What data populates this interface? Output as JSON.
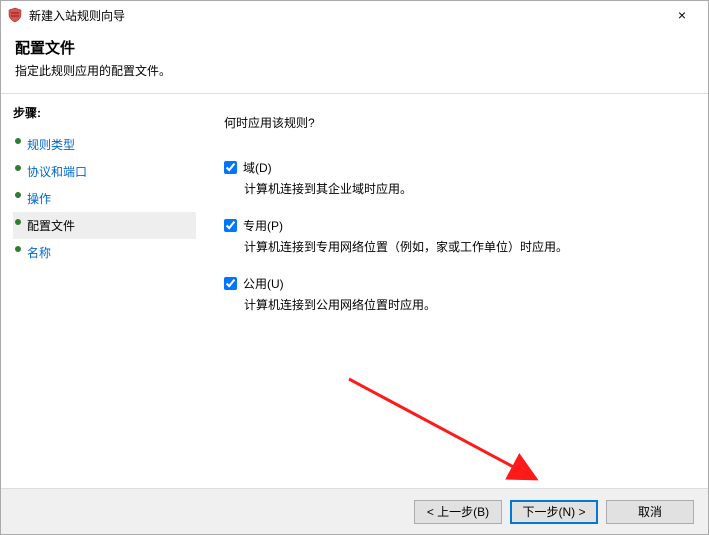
{
  "window": {
    "title": "新建入站规则向导",
    "close_label": "×"
  },
  "header": {
    "title": "配置文件",
    "subtitle": "指定此规则应用的配置文件。"
  },
  "sidebar": {
    "steps_label": "步骤:",
    "items": [
      {
        "label": "规则类型",
        "current": false
      },
      {
        "label": "协议和端口",
        "current": false
      },
      {
        "label": "操作",
        "current": false
      },
      {
        "label": "配置文件",
        "current": true
      },
      {
        "label": "名称",
        "current": false
      }
    ]
  },
  "main": {
    "prompt": "何时应用该规则?",
    "options": [
      {
        "checked": true,
        "label": "域(D)",
        "desc": "计算机连接到其企业域时应用。"
      },
      {
        "checked": true,
        "label": "专用(P)",
        "desc": "计算机连接到专用网络位置（例如，家或工作单位）时应用。"
      },
      {
        "checked": true,
        "label": "公用(U)",
        "desc": "计算机连接到公用网络位置时应用。"
      }
    ]
  },
  "footer": {
    "back": "< 上一步(B)",
    "next": "下一步(N) >",
    "cancel": "取消"
  }
}
